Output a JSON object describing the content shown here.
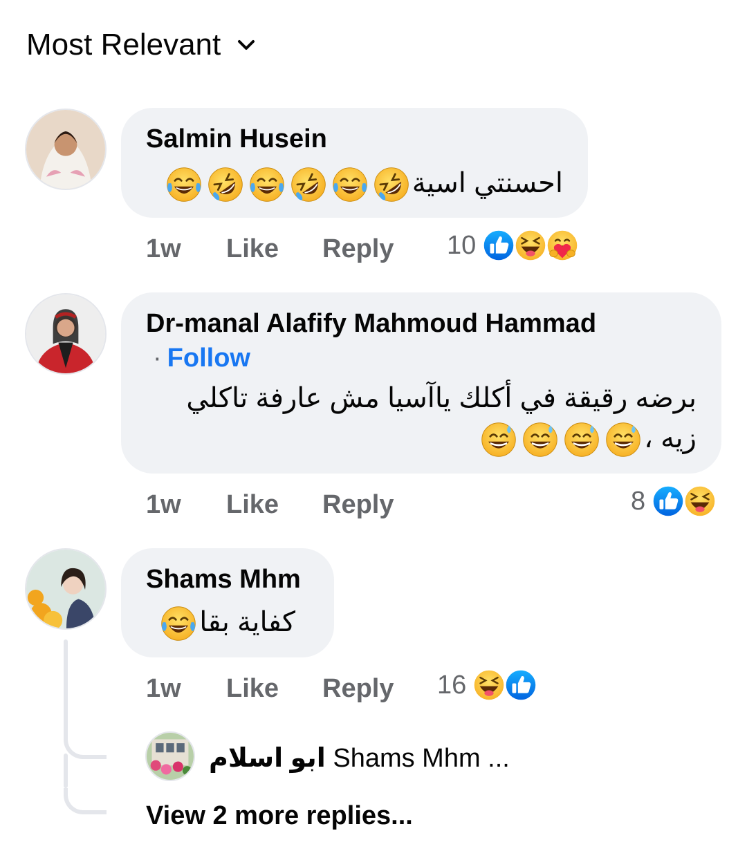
{
  "sort": {
    "label": "Most Relevant",
    "icon": "chevron-down-icon"
  },
  "comments": [
    {
      "author": "Salmin Husein",
      "text": "احسنتي اسية",
      "emojis": [
        "rofl",
        "joy",
        "rofl",
        "joy",
        "rofl",
        "joy"
      ],
      "time": "1w",
      "like_label": "Like",
      "reply_label": "Reply",
      "reaction_count": "10",
      "reactions": [
        "like",
        "haha",
        "care"
      ]
    },
    {
      "author": "Dr-manal Alafify Mahmoud Hammad",
      "follow_dot": "·",
      "follow_label": "Follow",
      "text_line1": "برضه رقيقة في أكلك ياآسيا مش عارفة تاكلي",
      "text_line2": "زيه ،",
      "emojis": [
        "sweat-smile",
        "sweat-smile",
        "sweat-smile",
        "sweat-smile"
      ],
      "time": "1w",
      "like_label": "Like",
      "reply_label": "Reply",
      "reaction_count": "8",
      "reactions": [
        "like",
        "haha"
      ]
    },
    {
      "author": "Shams Mhm",
      "text": "كفاية بقا",
      "emojis": [
        "joy"
      ],
      "time": "1w",
      "like_label": "Like",
      "reply_label": "Reply",
      "reaction_count": "16",
      "reactions": [
        "haha",
        "like"
      ]
    }
  ],
  "reply_preview": {
    "author": "ابو اسلام",
    "text": "Shams Mhm ..."
  },
  "view_more_label": "View 2 more replies..."
}
